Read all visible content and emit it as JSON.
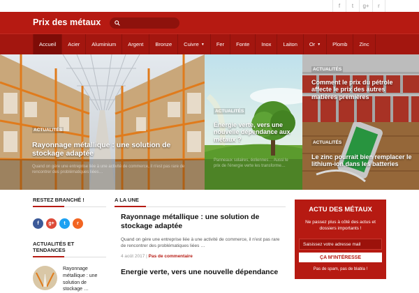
{
  "topbar": {
    "social": [
      {
        "icon": "facebook-icon",
        "glyph": "f"
      },
      {
        "icon": "twitter-icon",
        "glyph": "t"
      },
      {
        "icon": "google-plus-icon",
        "glyph": "g+"
      },
      {
        "icon": "rss-icon",
        "glyph": "r"
      }
    ]
  },
  "header": {
    "site_title": "Prix des métaux",
    "search_placeholder": ""
  },
  "nav": {
    "items": [
      {
        "label": "Accueil",
        "active": true,
        "dropdown": false
      },
      {
        "label": "Acier",
        "active": false,
        "dropdown": false
      },
      {
        "label": "Aluminium",
        "active": false,
        "dropdown": false
      },
      {
        "label": "Argent",
        "active": false,
        "dropdown": false
      },
      {
        "label": "Bronze",
        "active": false,
        "dropdown": false
      },
      {
        "label": "Cuivre",
        "active": false,
        "dropdown": true
      },
      {
        "label": "Fer",
        "active": false,
        "dropdown": false
      },
      {
        "label": "Fonte",
        "active": false,
        "dropdown": false
      },
      {
        "label": "Inox",
        "active": false,
        "dropdown": false
      },
      {
        "label": "Laiton",
        "active": false,
        "dropdown": false
      },
      {
        "label": "Or",
        "active": false,
        "dropdown": true
      },
      {
        "label": "Plomb",
        "active": false,
        "dropdown": false
      },
      {
        "label": "Zinc",
        "active": false,
        "dropdown": false
      }
    ]
  },
  "hero": {
    "tiles": [
      {
        "category": "Actualités",
        "title": "Rayonnage métallique : une solution de stockage adaptée",
        "excerpt": "Quand on gère une entreprise liée à une activité de commerce, il n'est pas rare de rencontrer des problématiques liées…"
      },
      {
        "category": "Actualités",
        "title": "Énergie verte, vers une nouvelle dépendance aux métaux ?",
        "excerpt": "Panneaux solaires, éoliennes… Aussi le prix de l'énergie verte les transforme…"
      },
      {
        "category": "Actualités",
        "title": "Comment le prix du pétrole affecte le prix des autres matières premières",
        "excerpt": ""
      },
      {
        "category": "Actualités",
        "title": "Le zinc pourrait bien remplacer le lithium-ion dans les batteries",
        "excerpt": ""
      }
    ]
  },
  "left": {
    "stay_connected": "RESTEZ BRANCHÉ !",
    "social": [
      {
        "icon": "facebook-icon",
        "glyph": "f",
        "color": "#3b5998"
      },
      {
        "icon": "google-plus-icon",
        "glyph": "g+",
        "color": "#dd4b39"
      },
      {
        "icon": "twitter-icon",
        "glyph": "t",
        "color": "#1da1f2"
      },
      {
        "icon": "rss-icon",
        "glyph": "r",
        "color": "#f26522"
      }
    ],
    "news_heading": "ACTUALITÉS ET TENDANCES",
    "news_item": "Rayonnage métallique : une solution de stockage …"
  },
  "main": {
    "heading": "A LA UNE",
    "articles": [
      {
        "title": "Rayonnage métallique : une solution de stockage adaptée",
        "excerpt": "Quand on gère une entreprise liée à une activité de commerce, il n'est pas rare de rencontrer des problématiques liées …",
        "date": "4 août 2017",
        "comments": "Pas de commentaire"
      },
      {
        "title": "Energie verte, vers une nouvelle dépendance"
      }
    ]
  },
  "newsletter": {
    "title": "ACTU DES MÉTAUX",
    "subtitle": "Ne passez plus à côté des actus et dossiers importants !",
    "email_placeholder": "Saisissez votre adresse mail",
    "button": "ÇA M'INTÉRESSE",
    "fine_print": "Pas de spam, pas de blabla !"
  },
  "colors": {
    "brand": "#b61a12",
    "nav": "#a3160f",
    "nav_active": "#7e0c07"
  }
}
